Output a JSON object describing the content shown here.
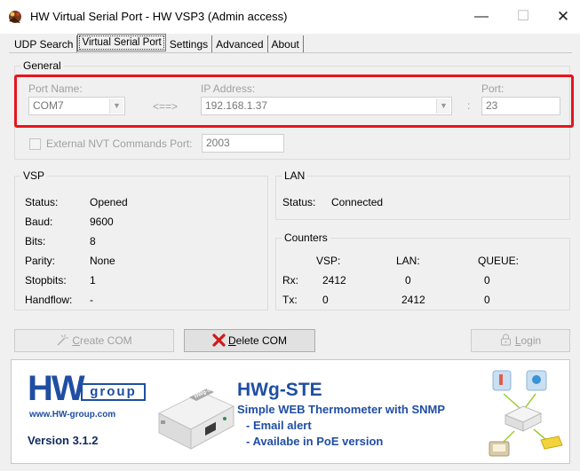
{
  "window": {
    "title": "HW Virtual Serial Port - HW VSP3 (Admin access)",
    "minimize": "—",
    "maximize": "☐",
    "close": "✕"
  },
  "tabs": [
    "UDP Search",
    "Virtual Serial Port",
    "Settings",
    "Advanced",
    "About"
  ],
  "active_tab": "Virtual Serial Port",
  "general": {
    "group_label": "General",
    "port_name_label": "Port Name:",
    "port_name_value": "COM7",
    "arrow": "<==>",
    "ip_label": "IP Address:",
    "ip_value": "192.168.1.37",
    "colon": ":",
    "port_label": "Port:",
    "port_value": "23",
    "nvt_label": "External NVT Commands Port:",
    "nvt_value": "2003",
    "nvt_checked": false
  },
  "vsp": {
    "group_label": "VSP",
    "rows": [
      {
        "label": "Status:",
        "value": "Opened"
      },
      {
        "label": "Baud:",
        "value": "9600"
      },
      {
        "label": "Bits:",
        "value": "8"
      },
      {
        "label": "Parity:",
        "value": "None"
      },
      {
        "label": "Stopbits:",
        "value": "1"
      },
      {
        "label": "Handflow:",
        "value": "-"
      }
    ]
  },
  "lan": {
    "group_label": "LAN",
    "status_label": "Status:",
    "status_value": "Connected"
  },
  "counters": {
    "group_label": "Counters",
    "headers": [
      "VSP:",
      "LAN:",
      "QUEUE:"
    ],
    "rows": [
      {
        "label": "Rx:",
        "values": [
          "2412",
          "0",
          "0"
        ]
      },
      {
        "label": "Tx:",
        "values": [
          "0",
          "2412",
          "0"
        ]
      }
    ]
  },
  "buttons": {
    "create_prefix": "",
    "create_underline": "C",
    "create_rest": "reate COM",
    "delete_underline": "D",
    "delete_rest": "elete COM",
    "login_underline": "L",
    "login_rest": "ogin"
  },
  "banner": {
    "logo_hw": "HW",
    "logo_group": "group",
    "url": "www.HW-group.com",
    "version": "Version  3.1.2",
    "product_title": "HWg-STE",
    "product_subtitle": "Simple WEB Thermometer with SNMP",
    "bullet1": "- Email alert",
    "bullet2": "- Availabe in PoE version",
    "device_label": "HWg-STE"
  },
  "colors": {
    "highlight": "#e8141c",
    "brand_blue": "#1f4ea3",
    "delete_x": "#d01a1a"
  }
}
